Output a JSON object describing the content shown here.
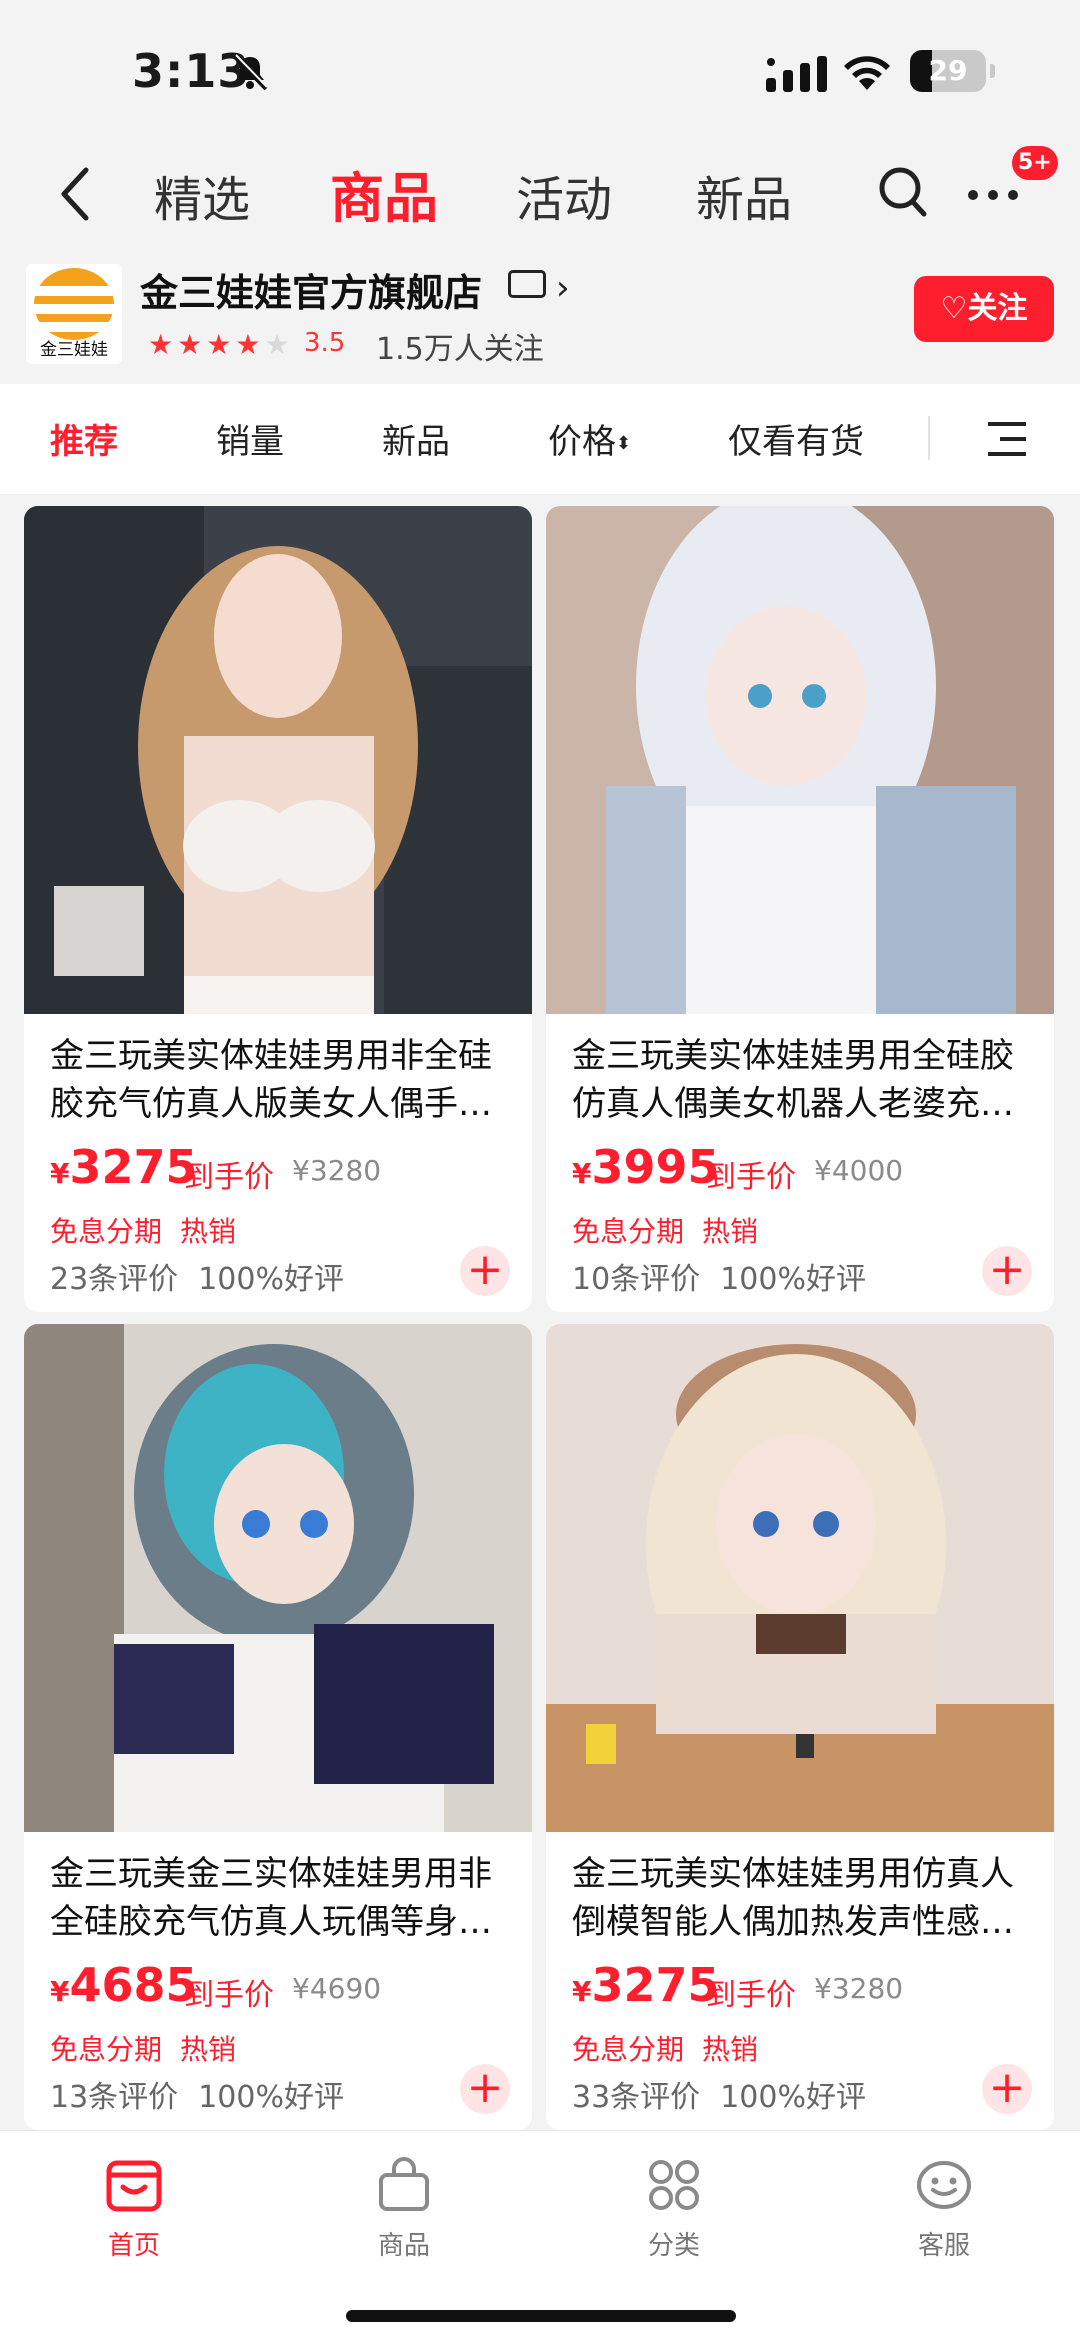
{
  "status_bar": {
    "time": "3:13",
    "battery": "29",
    "battery_level": 0.29
  },
  "nav": {
    "tabs": [
      {
        "label": "精选",
        "active": false
      },
      {
        "label": "商品",
        "active": true
      },
      {
        "label": "活动",
        "active": false
      },
      {
        "label": "新品",
        "active": false
      }
    ],
    "badge": "5+"
  },
  "shop": {
    "logo_text": "金三娃娃",
    "name": "金三娃娃官方旗舰店",
    "rating": "3.5",
    "rating_value": 3.5,
    "followers": "1.5万人关注",
    "follow_label": "关注"
  },
  "filters": [
    {
      "label": "推荐",
      "active": true
    },
    {
      "label": "销量",
      "active": false
    },
    {
      "label": "新品",
      "active": false
    },
    {
      "label": "价格",
      "active": false
    },
    {
      "label": "仅看有货",
      "active": false
    }
  ],
  "products": [
    {
      "title": "金三玩美实体娃娃男用非全硅胶充气仿真人版美女人偶手…",
      "currency": "¥",
      "price": "3275",
      "deal_label": "到手价",
      "original_price": "¥3280",
      "tags": [
        "免息分期",
        "热销"
      ],
      "reviews": "23条评价",
      "positive": "100%好评"
    },
    {
      "title": "金三玩美实体娃娃男用全硅胶仿真人偶美女机器人老婆充…",
      "currency": "¥",
      "price": "3995",
      "deal_label": "到手价",
      "original_price": "¥4000",
      "tags": [
        "免息分期",
        "热销"
      ],
      "reviews": "10条评价",
      "positive": "100%好评"
    },
    {
      "title": "金三玩美金三实体娃娃男用非全硅胶充气仿真人玩偶等身…",
      "currency": "¥",
      "price": "4685",
      "deal_label": "到手价",
      "original_price": "¥4690",
      "tags": [
        "免息分期",
        "热销"
      ],
      "reviews": "13条评价",
      "positive": "100%好评"
    },
    {
      "title": "金三玩美实体娃娃男用仿真人倒模智能人偶加热发声性感…",
      "currency": "¥",
      "price": "3275",
      "deal_label": "到手价",
      "original_price": "¥3280",
      "tags": [
        "免息分期",
        "热销"
      ],
      "reviews": "33条评价",
      "positive": "100%好评"
    }
  ],
  "bottom_tabs": [
    {
      "label": "首页",
      "icon": "shop-icon",
      "active": true
    },
    {
      "label": "商品",
      "icon": "bag-icon",
      "active": false
    },
    {
      "label": "分类",
      "icon": "category-icon",
      "active": false
    },
    {
      "label": "客服",
      "icon": "customer-service-icon",
      "active": false
    }
  ],
  "colors": {
    "accent": "#ff1e2e",
    "background": "#f3f3f3"
  }
}
